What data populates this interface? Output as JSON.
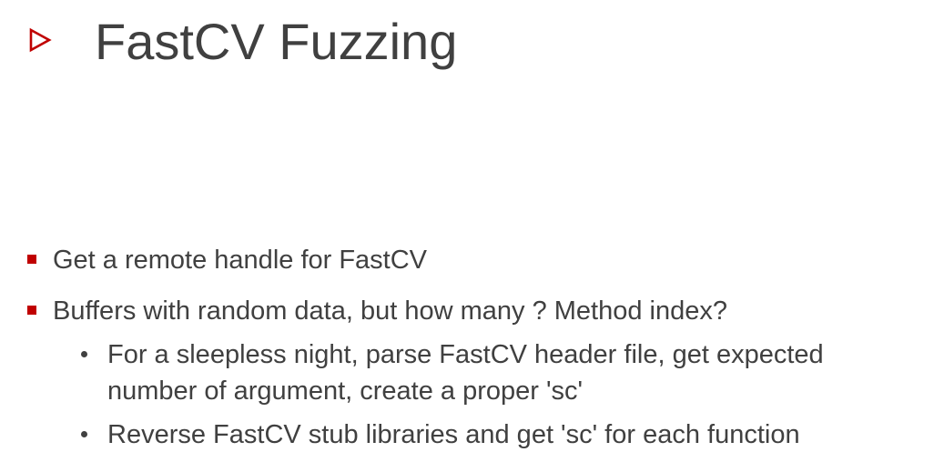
{
  "slide": {
    "title": "FastCV Fuzzing",
    "accent_color": "#c00000",
    "title_marker_icon": "triangle-right-outline-icon",
    "bullets": [
      {
        "text": "Get a remote handle for FastCV"
      },
      {
        "text": "Buffers with random data, but how many ? Method index?",
        "sub": [
          {
            "lines": [
              "For a sleepless night, parse FastCV header file, get expected",
              "number of argument, create a proper 'sc'"
            ]
          },
          {
            "lines": [
              "Reverse FastCV stub libraries and get 'sc' for each function"
            ]
          }
        ]
      }
    ]
  }
}
